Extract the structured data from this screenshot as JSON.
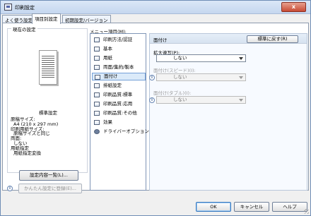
{
  "window": {
    "title": "印刷設定",
    "close_label": "x"
  },
  "tabs": [
    {
      "label": "よく使う設定"
    },
    {
      "label": "項目別設定"
    },
    {
      "label": "初期設定/バージョン"
    }
  ],
  "current_setting": {
    "group_title": "現在の設定",
    "name": "標準設定",
    "summary": [
      "原稿サイズ:",
      "A4 (210 x 297 mm)",
      "印刷用紙サイズ:",
      "原稿サイズと同じ",
      "両面:",
      "しない",
      "用紙指定",
      "用紙指定変換"
    ],
    "list_button": "設定内容一覧(L)...",
    "easy_button": "かんたん設定に登録(E)..."
  },
  "menu": {
    "label": "メニュー項目(M):",
    "items": [
      {
        "label": "印刷方法/認証"
      },
      {
        "label": "基本"
      },
      {
        "label": "用紙"
      },
      {
        "label": "両面/集約/製本"
      },
      {
        "label": "面付け"
      },
      {
        "label": "排紙設定"
      },
      {
        "label": "印刷品質:標準"
      },
      {
        "label": "印刷品質:応用"
      },
      {
        "label": "印刷品質:その他"
      },
      {
        "label": "効果"
      },
      {
        "label": "ドライバーオプション"
      }
    ]
  },
  "panel": {
    "title": "面付け",
    "reset_button": "標準に戻す(R)",
    "fields": [
      {
        "label": "拡大連写(P):",
        "value": "しない",
        "enabled": true
      },
      {
        "label": "面付け(スピード)(I):",
        "value": "しない",
        "enabled": false
      },
      {
        "label": "面付け(タブル)(I):",
        "value": "しない",
        "enabled": false
      }
    ]
  },
  "footer": {
    "ok": "OK",
    "cancel": "キャンセル",
    "help": "ヘルプ"
  },
  "colors": {
    "accent": "#74a0d8",
    "selection": "#dbeaf9"
  }
}
